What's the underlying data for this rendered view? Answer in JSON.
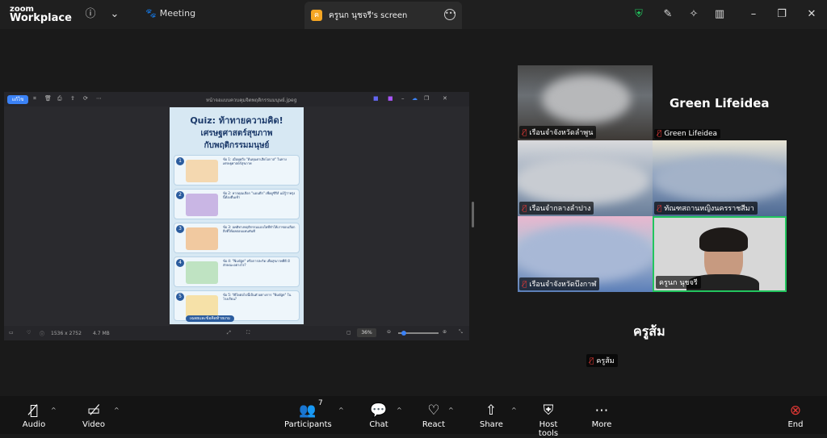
{
  "app": {
    "logo_line1": "zoom",
    "logo_line2": "Workplace"
  },
  "titlebar": {
    "meeting_tab_label": "Meeting",
    "screen_tab_label": "ครูนก นุชจรี's screen",
    "screen_tab_badge": "ค",
    "icons": [
      "info-icon",
      "chevron-down-icon",
      "shield-check-icon",
      "pen-icon",
      "sparkle-icon",
      "layout-icon",
      "minimize-icon",
      "restore-icon",
      "close-icon"
    ]
  },
  "shared_screen": {
    "viewer_button": "แก้ไข",
    "file_name": "หน้าจอแบบควบคุมจิตพฤติกรรมมนุษย์.jpeg",
    "dimensions_text": "1536 x 2752",
    "file_size": "4.7 MB",
    "zoom_level": "36%",
    "zoom_fraction": 0.1,
    "poster": {
      "title": "Quiz: ท้าทายความคิด!",
      "subtitle1": "เศรษฐศาสตร์สุขภาพ",
      "subtitle2": "กับพฤติกรรมมนุษย์",
      "questions": [
        {
          "n": "1",
          "text": "ข้อ 1: เมื่อพูดถึง \"ต้นทุนค่าเสียโอกาส\" ในทางเศรษฐศาสตร์สุขภาพ"
        },
        {
          "n": "2",
          "text": "ข้อ 2: หากคุณเลือก \"นอนดึก\" เพื่อดูซีรีส์ แม้รู้ว่าพรุ่งนี้ต้องตื่นเช้า"
        },
        {
          "n": "3",
          "text": "ข้อ 3: อคติทางพฤติกรรมแบบใดที่ทำให้เราชอบเลือกสิ่งที่ให้ผลตอบแทนทันที"
        },
        {
          "n": "4",
          "text": "ข้อ 4: \"Nudge\" หรือการสะกิด เพื่อสุขภาพที่ดี มีลักษณะอย่างไร?"
        },
        {
          "n": "5",
          "text": "ข้อ 5: วิธีใดต่อไปนี้เป็นตัวอย่างการ \"Nudge\" ในโรงเรียน?"
        }
      ],
      "footer": "เฉลยและข้อคิดท้ายเกม"
    }
  },
  "participants": [
    {
      "name": "เรือนจำจังหวัดลำพูน",
      "muted": true
    },
    {
      "name": "Green Lifeidea",
      "muted": true,
      "video_off": true
    },
    {
      "name": "เรือนจำกลางลำปาง",
      "muted": true
    },
    {
      "name": "ทัณฑสถานหญิงนครราชสีมา",
      "muted": true
    },
    {
      "name": "เรือนจำจังหวัดบึงกาฬ",
      "muted": true
    },
    {
      "name": "ครูนก นุชจรี",
      "muted": false,
      "active_speaker": true
    },
    {
      "name": "ครูส้ม",
      "muted": true,
      "video_off": true
    }
  ],
  "toolbar": {
    "audio": "Audio",
    "video": "Video",
    "participants": "Participants",
    "participants_count": "7",
    "chat": "Chat",
    "react": "React",
    "share": "Share",
    "host_tools": "Host tools",
    "more": "More",
    "end": "End"
  },
  "colors": {
    "accent": "#3b82f6",
    "active_speaker": "#22c55e",
    "muted": "#e53935",
    "end": "#e53935"
  }
}
